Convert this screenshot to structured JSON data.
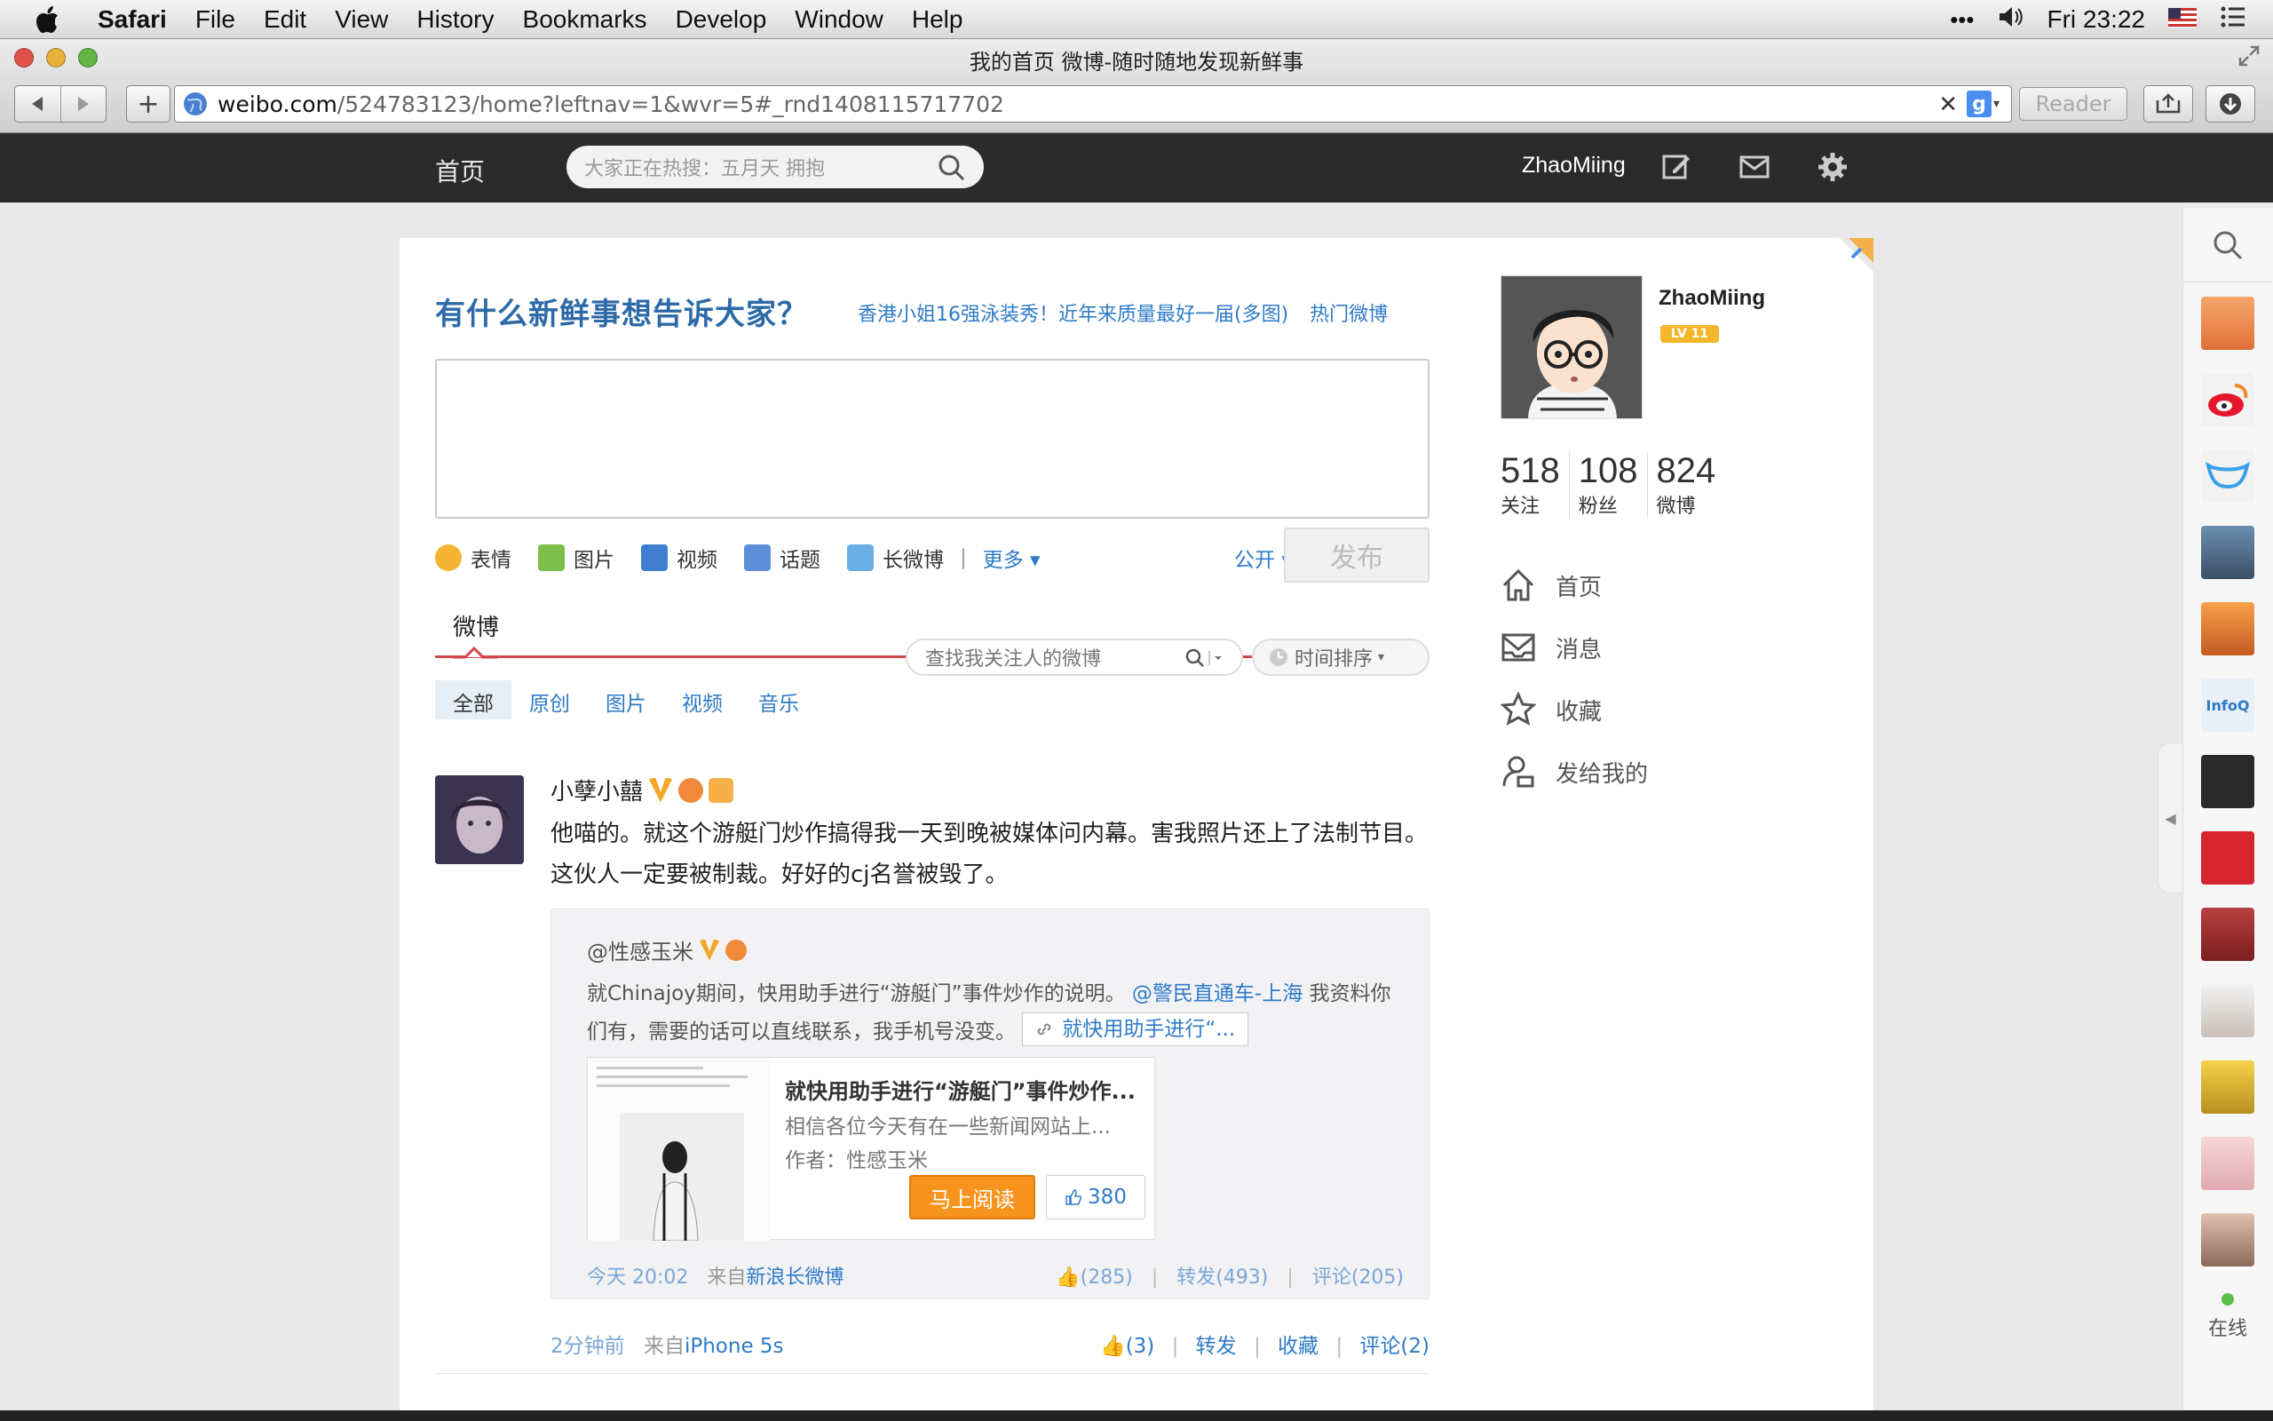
{
  "menubar": {
    "app": "Safari",
    "items": [
      "File",
      "Edit",
      "View",
      "History",
      "Bookmarks",
      "Develop",
      "Window",
      "Help"
    ],
    "clock": "Fri 23:22"
  },
  "browser": {
    "title": "我的首页 微博-随时随地发现新鲜事",
    "url_domain": "weibo.com",
    "url_rest": "/524783123/home?leftnav=1&wvr=5#_rnd1408115717702",
    "reader_label": "Reader"
  },
  "weibo_nav": {
    "home": "首页",
    "search_placeholder": "大家正在热搜：五月天 拥抱",
    "username": "ZhaoMiing"
  },
  "publisher": {
    "title": "有什么新鲜事想告诉大家？",
    "hot_link": "香港小姐16强泳装秀！近年来质量最好一届(多图)",
    "hot_more": "热门微博",
    "tools": [
      "表情",
      "图片",
      "视频",
      "话题",
      "长微博"
    ],
    "more": "更多",
    "visibility": "公开",
    "submit": "发布"
  },
  "feed": {
    "tab": "微博",
    "search_placeholder": "查找我关注人的微博",
    "sort": "时间排序",
    "filters": [
      "全部",
      "原创",
      "图片",
      "视频",
      "音乐"
    ]
  },
  "post": {
    "author": "小孽小囍",
    "text": "他喵的。就这个游艇门炒作搞得我一天到晚被媒体问内幕。害我照片还上了法制节目。这伙人一定要被制裁。好好的cj名誉被毁了。",
    "repost": {
      "author": "@性感玉米",
      "text": "就Chinajoy期间，快用助手进行“游艇门”事件炒作的说明。",
      "mention": "@警民直通车-上海",
      "text2": "我资料你们有，需要的话可以直线联系，我手机号没变。",
      "chip": "就快用助手进行“...",
      "article": {
        "title": "就快用助手进行“游艇门”事件炒作...",
        "desc": "相信各位今天有在一些新闻网站上...",
        "author": "作者：性感玉米",
        "read": "马上阅读",
        "likes": "380"
      },
      "time": "今天 20:02",
      "from_label": "来自",
      "source": "新浪长微博",
      "likes": "(285)",
      "forward": "转发(493)",
      "comment": "评论(205)"
    },
    "time": "2分钟前",
    "from_label": "来自",
    "source": "iPhone 5s",
    "likes": "(3)",
    "forward": "转发",
    "favorite": "收藏",
    "comment": "评论(2)"
  },
  "profile": {
    "name": "ZhaoMiing",
    "level": "LV 11",
    "stats": [
      {
        "n": "518",
        "l": "关注"
      },
      {
        "n": "108",
        "l": "粉丝"
      },
      {
        "n": "824",
        "l": "微博"
      }
    ],
    "nav": [
      "首页",
      "消息",
      "收藏",
      "发给我的"
    ]
  },
  "sidebar": {
    "online": "在线"
  }
}
